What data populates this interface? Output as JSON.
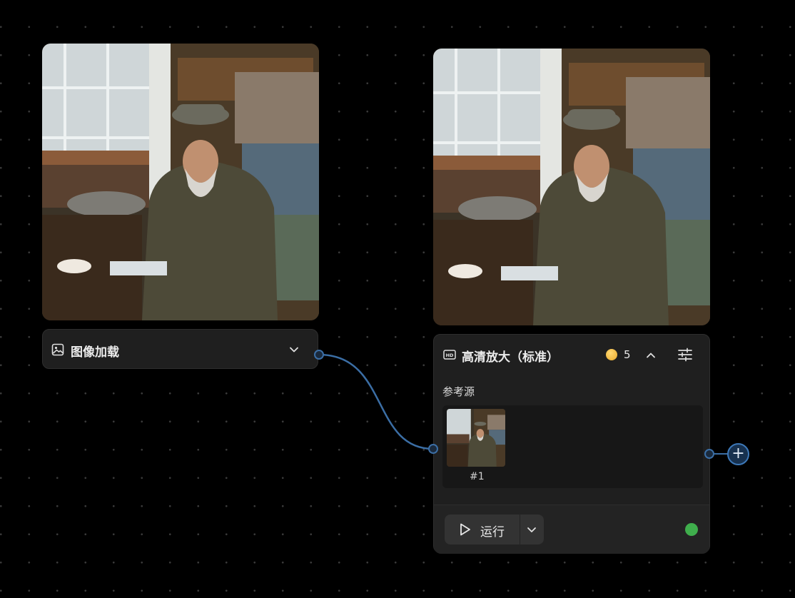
{
  "image_loader": {
    "title": "图像加载",
    "icon": "image-icon",
    "menu_icon": "chevron-down-icon"
  },
  "upscale_node": {
    "title": "高清放大（标准）",
    "icon": "hd-icon",
    "cost": "5",
    "cost_icon": "coin-icon",
    "reference_label": "参考源",
    "reference_index": "#1",
    "run_label": "运行",
    "status_color": "#3fae4c"
  },
  "colors": {
    "background": "#000000",
    "node": "#1f1f1f",
    "wire": "#3b6ea5",
    "status": "#3fae4c"
  }
}
